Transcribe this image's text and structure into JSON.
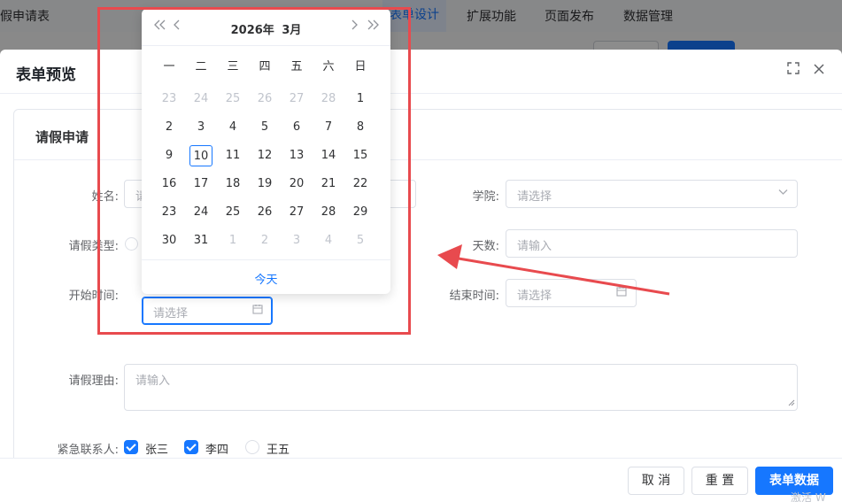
{
  "topbar": {
    "app_title": "假申请表",
    "menus": [
      "表单设计",
      "扩展功能",
      "页面发布",
      "数据管理"
    ]
  },
  "dialog": {
    "title": "表单预览",
    "fullscreen_icon": "fullscreen-icon",
    "close_icon": "close-icon"
  },
  "form": {
    "section_title": "请假申请",
    "name": {
      "label": "姓名:",
      "placeholder": "请"
    },
    "college": {
      "label": "学院:",
      "placeholder": "请选择"
    },
    "leave_type": {
      "label": "请假类型:"
    },
    "days": {
      "label": "天数:",
      "placeholder": "请输入"
    },
    "start_time": {
      "label": "开始时间:",
      "placeholder": "请选择"
    },
    "end_time": {
      "label": "结束时间:",
      "placeholder": "请选择"
    },
    "reason": {
      "label": "请假理由:",
      "placeholder": "请输入"
    },
    "emergency": {
      "label": "紧急联系人:",
      "options": [
        {
          "label": "张三",
          "checked": true
        },
        {
          "label": "李四",
          "checked": true
        },
        {
          "label": "王五",
          "checked": false
        }
      ]
    }
  },
  "footer": {
    "cancel": "取 消",
    "reset": "重 置",
    "submit": "表单数据",
    "watermark": "激活 W"
  },
  "datepicker": {
    "year": "2026年",
    "month": "3月",
    "weekdays": [
      "一",
      "二",
      "三",
      "四",
      "五",
      "六",
      "日"
    ],
    "weeks": [
      [
        [
          "23",
          1
        ],
        [
          "24",
          1
        ],
        [
          "25",
          1
        ],
        [
          "26",
          1
        ],
        [
          "27",
          1
        ],
        [
          "28",
          1
        ],
        [
          "1",
          0
        ]
      ],
      [
        [
          "2",
          0
        ],
        [
          "3",
          0
        ],
        [
          "4",
          0
        ],
        [
          "5",
          0
        ],
        [
          "6",
          0
        ],
        [
          "7",
          0
        ],
        [
          "8",
          0
        ]
      ],
      [
        [
          "9",
          0
        ],
        [
          "10",
          2
        ],
        [
          "11",
          0
        ],
        [
          "12",
          0
        ],
        [
          "13",
          0
        ],
        [
          "14",
          0
        ],
        [
          "15",
          0
        ]
      ],
      [
        [
          "16",
          0
        ],
        [
          "17",
          0
        ],
        [
          "18",
          0
        ],
        [
          "19",
          0
        ],
        [
          "20",
          0
        ],
        [
          "21",
          0
        ],
        [
          "22",
          0
        ]
      ],
      [
        [
          "23",
          0
        ],
        [
          "24",
          0
        ],
        [
          "25",
          0
        ],
        [
          "26",
          0
        ],
        [
          "27",
          0
        ],
        [
          "28",
          0
        ],
        [
          "29",
          0
        ]
      ],
      [
        [
          "30",
          0
        ],
        [
          "31",
          0
        ],
        [
          "1",
          1
        ],
        [
          "2",
          1
        ],
        [
          "3",
          1
        ],
        [
          "4",
          1
        ],
        [
          "5",
          1
        ]
      ]
    ],
    "today_label": "今天"
  },
  "colors": {
    "primary": "#1677ff",
    "annotation": "#e84a4e"
  }
}
